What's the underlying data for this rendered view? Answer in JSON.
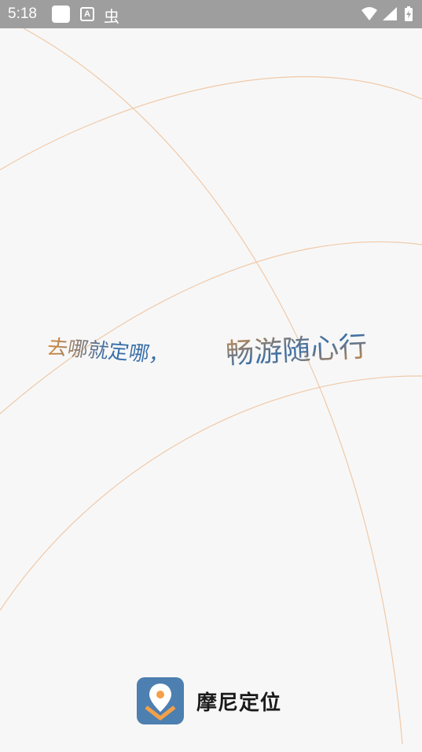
{
  "status_bar": {
    "time": "5:18",
    "notification_letter": "A",
    "notification_glyph": "虫",
    "icons": [
      "square-notification-icon",
      "a-notification-icon",
      "bug-notification-icon",
      "wifi-icon",
      "cell-signal-icon",
      "battery-charging-icon"
    ]
  },
  "splash": {
    "tagline_part1": "去哪就定哪，",
    "tagline_part2": "畅游随心行",
    "app_name": "摩尼定位"
  },
  "colors": {
    "status_bar_bg": "#9e9e9e",
    "background": "#f7f7f7",
    "arc_stroke": "#f0c9a8",
    "tagline_blue": "#3a6fa8",
    "tagline_orange": "#d98b3c",
    "logo_bg": "#4d7fb0",
    "logo_accent": "#f3a04a"
  }
}
